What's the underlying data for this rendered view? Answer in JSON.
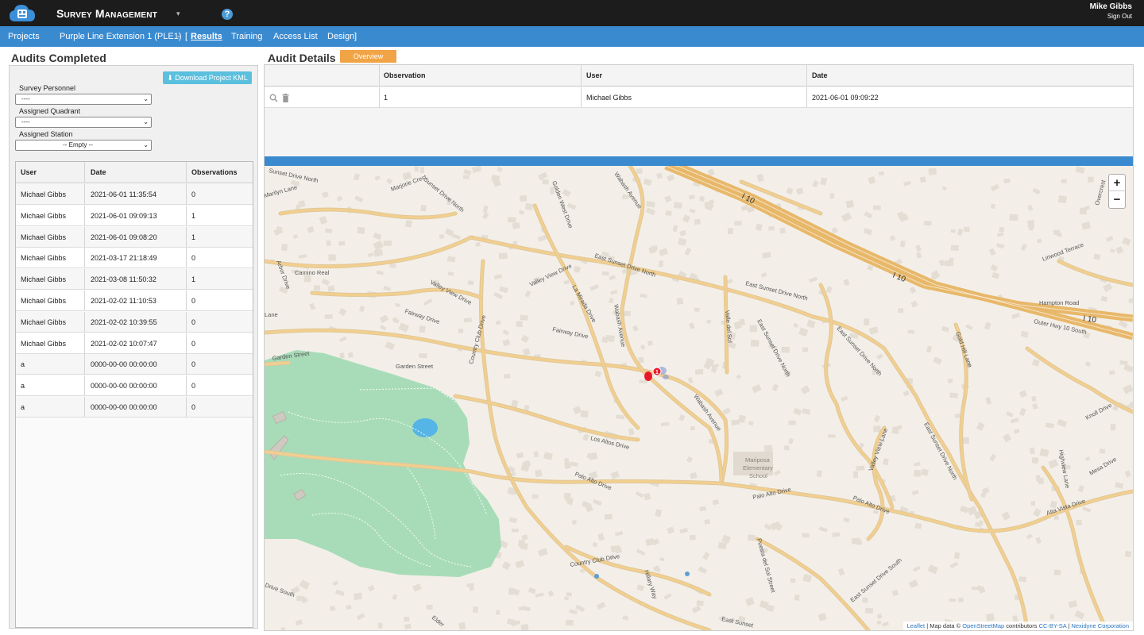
{
  "topbar": {
    "app_title": "Survey Management",
    "help_icon": "?",
    "caret": "▾",
    "user_name": "Mike Gibbs",
    "sign_out": "Sign Out"
  },
  "nav": {
    "projects": "Projects",
    "project_name": "Purple Line Extension 1 (PLE1)",
    "separator": "-",
    "bracket_open": "[",
    "results": "Results",
    "training": "Training",
    "access_list": "Access List",
    "design": "Design",
    "bracket_close": "]"
  },
  "left": {
    "title": "Audits Completed",
    "download_kml": "Download Project KML",
    "download_icon": "⬇",
    "filters": [
      {
        "label": "Survey Personnel",
        "value": "----"
      },
      {
        "label": "Assigned Quadrant",
        "value": "----"
      },
      {
        "label": "Assigned Station",
        "value": "-- Empty --"
      }
    ],
    "columns": [
      "User",
      "Date",
      "Observations"
    ],
    "rows": [
      {
        "user": "Michael Gibbs",
        "date": "2021-06-01 11:35:54",
        "obs": "0"
      },
      {
        "user": "Michael Gibbs",
        "date": "2021-06-01 09:09:13",
        "obs": "1"
      },
      {
        "user": "Michael Gibbs",
        "date": "2021-06-01 09:08:20",
        "obs": "1"
      },
      {
        "user": "Michael Gibbs",
        "date": "2021-03-17 21:18:49",
        "obs": "0"
      },
      {
        "user": "Michael Gibbs",
        "date": "2021-03-08 11:50:32",
        "obs": "1"
      },
      {
        "user": "Michael Gibbs",
        "date": "2021-02-02 11:10:53",
        "obs": "0"
      },
      {
        "user": "Michael Gibbs",
        "date": "2021-02-02 10:39:55",
        "obs": "0"
      },
      {
        "user": "Michael Gibbs",
        "date": "2021-02-02 10:07:47",
        "obs": "0"
      },
      {
        "user": "a",
        "date": "0000-00-00 00:00:00",
        "obs": "0"
      },
      {
        "user": "a",
        "date": "0000-00-00 00:00:00",
        "obs": "0"
      },
      {
        "user": "a",
        "date": "0000-00-00 00:00:00",
        "obs": "0"
      }
    ]
  },
  "right": {
    "title": "Audit Details",
    "overview": "Overview",
    "columns": [
      "Observation",
      "User",
      "Date"
    ],
    "row": {
      "observation": "1",
      "user": "Michael Gibbs",
      "date": "2021-06-01 09:09:22"
    }
  },
  "map": {
    "zoom_in": "+",
    "zoom_out": "−",
    "marker_count": "1",
    "park_color": "#a8dcb8",
    "road_color": "#f2cf8e",
    "highway_color": "#e8b86a",
    "water_color": "#55b5e6",
    "labels": {
      "i10_a": "I 10",
      "i10_b": "I 10",
      "i10_c": "I 10",
      "east_sunset_north": "East Sunset Drive North",
      "east_sunset_north_2": "East Sunset Drive North",
      "east_sunset_north_3": "East Sunset Drive North",
      "east_sunset_north_4": "East Sunset Drive North",
      "east_sunset_south": "East Sunset Drive South",
      "sunset_north": "Sunset Drive North",
      "sunset_north_2": "Sunset Drive North",
      "marjorie": "Marjorie Crest",
      "marilyn": "Marilyn Lane",
      "golden_west": "Golden West Drive",
      "wabash": "Wabash Avenue",
      "wabash_2": "Wabash Avenue",
      "wabash_3": "Wabash Avenue",
      "linwood": "Linwood Terrace",
      "overcrest": "Overcrest",
      "hampton": "Hampton Road",
      "outer_hwy": "Outer Hwy 10 South",
      "gold_hill": "Gold Hill Lane",
      "camino_real": "Camino Real",
      "arbor": "Arbor Drive",
      "valley_view": "Valley View Drive",
      "valley_view_2": "Valley View Drive",
      "valley_view_lane": "Valley View Lane",
      "la_mirada": "La Mirada Drive",
      "valle_del_sol": "Valle del Sol",
      "fairway": "Fairway Drive",
      "fairway_2": "Fairway Drive",
      "country_club": "Country Club Drive",
      "country_club_2": "Country Club Drive",
      "garden_street": "Garden Street",
      "garden_street_2": "Garden Street",
      "los_altos": "Los Altos Drive",
      "palo_alto": "Palo Alto Drive",
      "palo_alto_2": "Palo Alto Drive",
      "palo_alto_3": "Palo Alto Drive",
      "alta_vista": "Alta Vista Drive",
      "mariposa": "Mariposa",
      "elementary": "Elementary",
      "school": "School",
      "knoll": "Knoll Drive",
      "mesa": "Mesa Drive",
      "highview": "Highview Lane",
      "hillary": "Hillary Way",
      "puesta": "Puesta del Sol Street",
      "elder": "Elder",
      "east_sunset_bottom": "East Sunset",
      "ridge_lane": "Lane",
      "drive_south": "Drive South",
      "drive_north_left": "Sunset Drive North"
    },
    "attribution": {
      "leaflet": "Leaflet",
      "mapdata": "| Map data ©",
      "osm": "OpenStreetMap",
      "contributors": "contributors",
      "cc": "CC-BY-SA",
      "sep": "|",
      "nexidyne": "Nexidyne Corporation"
    }
  }
}
